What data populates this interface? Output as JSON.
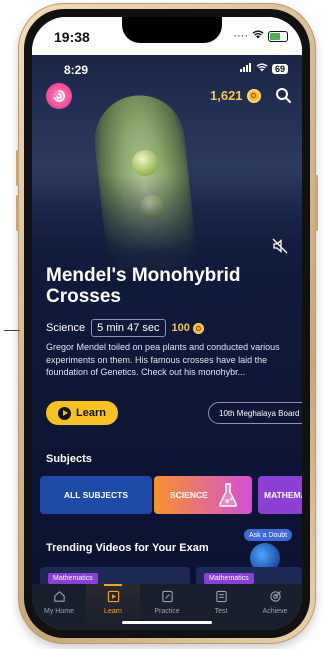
{
  "device": {
    "ios_time": "19:38"
  },
  "app_status": {
    "time": "8:29",
    "battery": "69"
  },
  "header": {
    "coins": "1,621"
  },
  "video": {
    "title": "Mendel's Monohybrid Crosses",
    "subject": "Science",
    "duration": "5 min 47 sec",
    "coins": "100",
    "description": "Gregor Mendel toiled on pea plants and conducted various experiments on them. His famous crosses have laid the foundation of Genetics. Check out his monohybr...",
    "learn_label": "Learn",
    "board_label": "10th Meghalaya Board"
  },
  "subjects": {
    "title": "Subjects",
    "chips": [
      "ALL SUBJECTS",
      "SCIENCE",
      "MATHEMATIC"
    ]
  },
  "trending": {
    "title": "Trending Videos for Your Exam",
    "ask_doubt": "Ask a Doubt",
    "cards": [
      {
        "tag": "Mathematics"
      },
      {
        "tag": "Mathematics"
      }
    ]
  },
  "bottom_nav": {
    "items": [
      {
        "label": "My Home",
        "icon": "home-icon"
      },
      {
        "label": "Learn",
        "icon": "learn-icon"
      },
      {
        "label": "Practice",
        "icon": "practice-icon"
      },
      {
        "label": "Test",
        "icon": "test-icon"
      },
      {
        "label": "Achieve",
        "icon": "achieve-icon"
      }
    ],
    "active": "Learn"
  },
  "colors": {
    "accent": "#f7c21e",
    "background": "#101a3c",
    "nav_active": "#f7a21e"
  }
}
